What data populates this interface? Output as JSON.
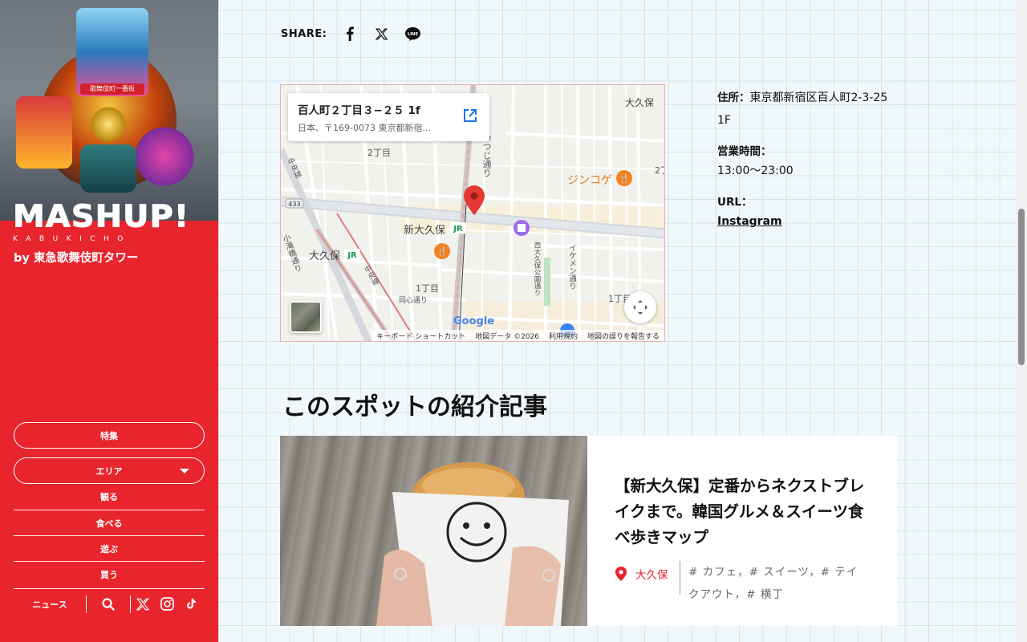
{
  "brand": {
    "logo": "MASHUP!",
    "logo_sub": "KABUKICHO",
    "byline": "by 東急歌舞伎町タワー",
    "art_sign": "歌舞伎町一番街"
  },
  "sidebar": {
    "pills": [
      {
        "label": "特集"
      },
      {
        "label": "エリア"
      }
    ],
    "nav": [
      {
        "label": "観る"
      },
      {
        "label": "食べる"
      },
      {
        "label": "遊ぶ"
      },
      {
        "label": "買う"
      }
    ],
    "footer": {
      "news": "ニュース"
    }
  },
  "share": {
    "label": "SHARE:"
  },
  "map": {
    "card_title": "百人町２丁目３−２５ 1f",
    "card_address": "日本、〒169-0073 東京都新宿...",
    "google": "Google",
    "footer_links": [
      "キーボード ショートカット",
      "地図データ ©2026",
      "利用規約",
      "地図の誤りを報告する"
    ],
    "labels": {
      "okubo_ne": "大久保",
      "chome2_top": "2丁目",
      "chome2_right": "2丁",
      "jinkoge": "ジンコゲ",
      "route433": "433",
      "shin_okubo": "新大久保",
      "okubo_station": "大久保",
      "chuo_line": "中央線",
      "chuo_line2": "中央線",
      "odaki": "小滝橋通り",
      "chome1_a": "1丁目",
      "chome1_b": "1丁目",
      "doshin": "同心通り",
      "nishi_okubo": "西大久保公園通り",
      "ikemen": "イケメン通り",
      "tsutsuji": "つつじ通り"
    }
  },
  "info": {
    "address_label": "住所：",
    "address_value": "東京都新宿区百人町2-3-25 1F",
    "hours_label": "営業時間：",
    "hours_value": "13:00〜23:00",
    "url_label": "URL：",
    "url_value": "Instagram"
  },
  "section": {
    "title": "このスポットの紹介記事"
  },
  "article": {
    "title": "【新大久保】定番からネクストブレイクまで。韓国グルメ＆スイーツ食べ歩きマップ",
    "area": "大久保",
    "tags": "# カフェ，# スイーツ，# テイクアウト，# 横丁"
  },
  "colors": {
    "brand_red": "#e8242d",
    "background": "#f1f8fb",
    "map_pin": "#e53935",
    "poi_orange": "#f48120"
  }
}
